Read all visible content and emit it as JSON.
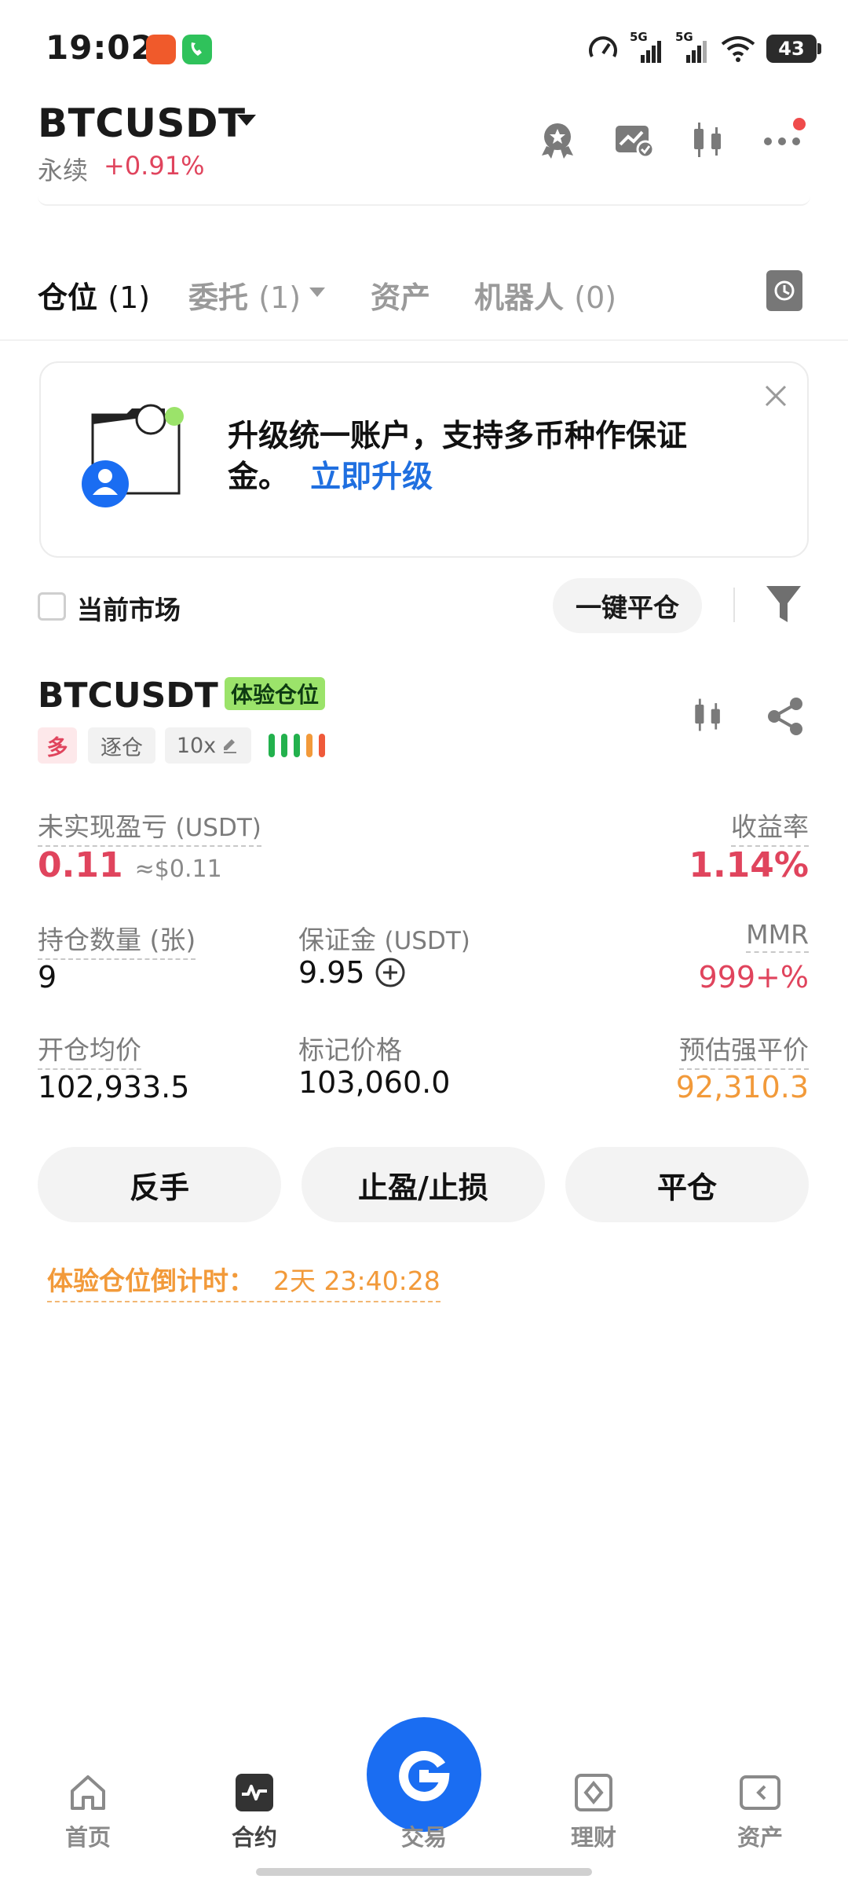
{
  "status_bar": {
    "time": "19:02",
    "network_1": "5G",
    "network_2": "5G",
    "battery": "43"
  },
  "header": {
    "pair": "BTCUSDT",
    "contract_type": "永续",
    "change": "+0.91%"
  },
  "tabs": [
    {
      "label": "仓位",
      "count": "(1)"
    },
    {
      "label": "委托",
      "count": "(1)"
    },
    {
      "label": "资产",
      "count": ""
    },
    {
      "label": "机器人",
      "count": "(0)"
    }
  ],
  "banner": {
    "text": "升级统一账户，支持多币种作保证金。",
    "link": "立即升级"
  },
  "filter": {
    "current_market": "当前市场",
    "close_all": "一键平仓"
  },
  "position": {
    "symbol": "BTCUSDT",
    "trial_badge": "体验仓位",
    "side": "多",
    "margin_mode": "逐仓",
    "leverage": "10x",
    "unrealized_pnl_label": "未实现盈亏",
    "unrealized_pnl_unit": "(USDT)",
    "unrealized_pnl": "0.11",
    "unrealized_pnl_usd": "≈$0.11",
    "roi_label": "收益率",
    "roi": "1.14%",
    "size_label": "持仓数量 (张)",
    "size": "9",
    "margin_label": "保证金",
    "margin_unit": "(USDT)",
    "margin": "9.95",
    "mmr_label": "MMR",
    "mmr": "999+%",
    "entry_label": "开仓均价",
    "entry_price": "102,933.5",
    "mark_label": "标记价格",
    "mark_price": "103,060.0",
    "liq_label": "预估强平价",
    "liq_price": "92,310.3",
    "btn_reverse": "反手",
    "btn_tpsl": "止盈/止损",
    "btn_close": "平仓",
    "countdown_label": "体验仓位倒计时：",
    "countdown_value": "2天 23:40:28"
  },
  "bottom_nav": [
    {
      "label": "首页",
      "icon": "home-icon"
    },
    {
      "label": "合约",
      "icon": "futures-icon"
    },
    {
      "label": "交易",
      "icon": "trade-icon"
    },
    {
      "label": "理财",
      "icon": "earn-icon"
    },
    {
      "label": "资产",
      "icon": "wallet-icon"
    }
  ],
  "colors": {
    "accent": "#1a6df2",
    "red": "#e0445d",
    "orange": "#f29a3a",
    "green": "#9be36a"
  }
}
